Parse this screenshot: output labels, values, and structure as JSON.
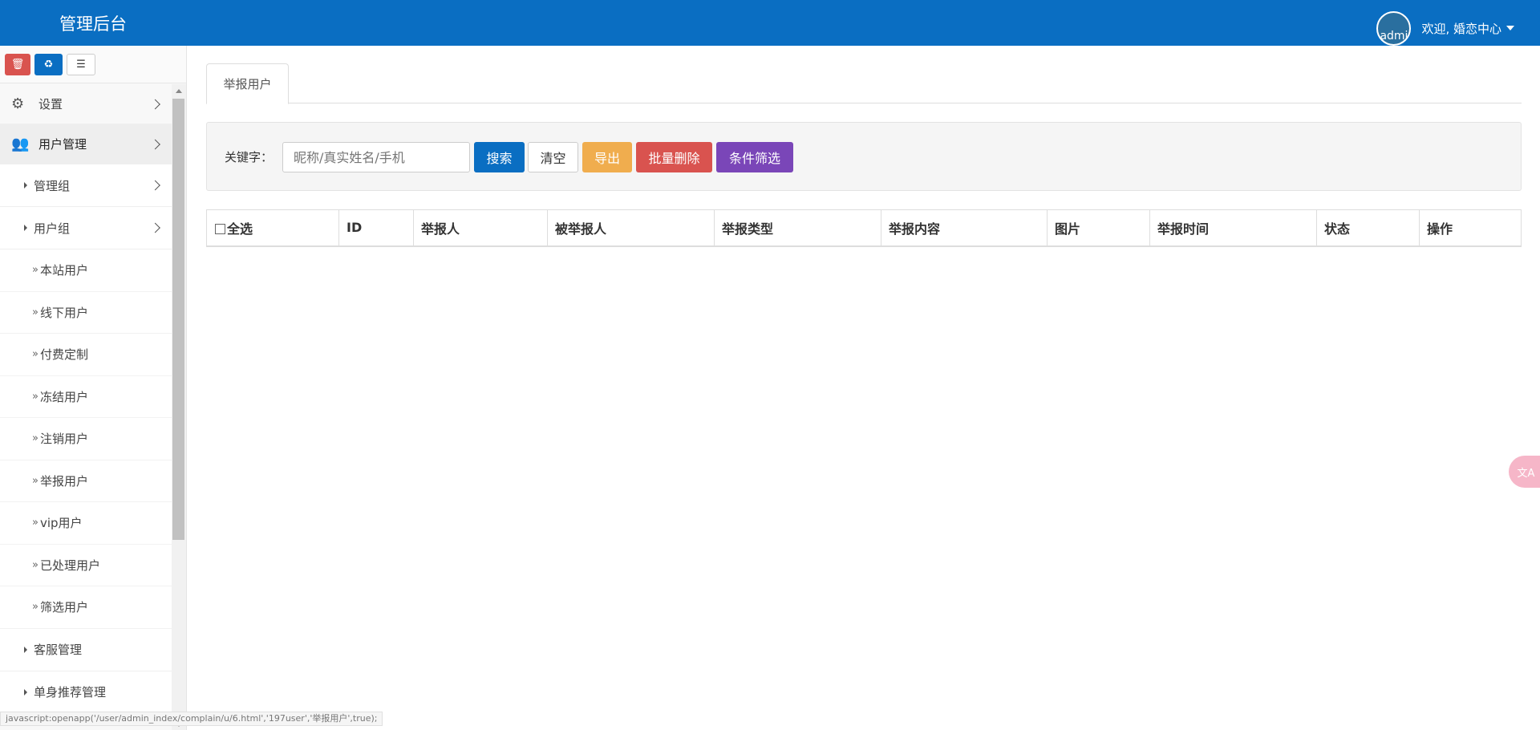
{
  "header": {
    "title": "管理后台",
    "avatar_alt": "admi",
    "welcome": "欢迎, 婚恋中心"
  },
  "sidebar": {
    "tools": [
      {
        "name": "delete-tool",
        "glyph": "🗑"
      },
      {
        "name": "recycle-tool",
        "glyph": "♻"
      },
      {
        "name": "list-tool",
        "glyph": "☰"
      }
    ],
    "items": [
      {
        "label": "设置",
        "icon": "gears-icon",
        "glyph": "⚙"
      },
      {
        "label": "用户管理",
        "icon": "users-icon",
        "glyph": "👥"
      }
    ],
    "groups": [
      {
        "label": "管理组"
      },
      {
        "label": "用户组"
      }
    ],
    "subitems": [
      "本站用户",
      "线下用户",
      "付费定制",
      "冻结用户",
      "注销用户",
      "举报用户",
      "vip用户",
      "已处理用户",
      "筛选用户"
    ],
    "more": [
      {
        "label": "客服管理"
      },
      {
        "label": "单身推荐管理"
      }
    ],
    "status_text": "javascript:openapp('/user/admin_index/complain/u/6.html','197user','举报用户',true);"
  },
  "main": {
    "tab": "举报用户",
    "search": {
      "label": "关键字：",
      "placeholder": "昵称/真实姓名/手机",
      "buttons": {
        "search": "搜索",
        "clear": "清空",
        "export": "导出",
        "batch_delete": "批量删除",
        "filter": "条件筛选"
      }
    },
    "table": {
      "select_all": "全选",
      "columns": [
        "ID",
        "举报人",
        "被举报人",
        "举报类型",
        "举报内容",
        "图片",
        "举报时间",
        "状态",
        "操作"
      ]
    }
  },
  "colors": {
    "primary": "#0a6ec2",
    "danger": "#d9534f",
    "warning": "#f0ad4e",
    "purple": "#7a46b8"
  },
  "floating": {
    "translate_glyph": "文A"
  }
}
